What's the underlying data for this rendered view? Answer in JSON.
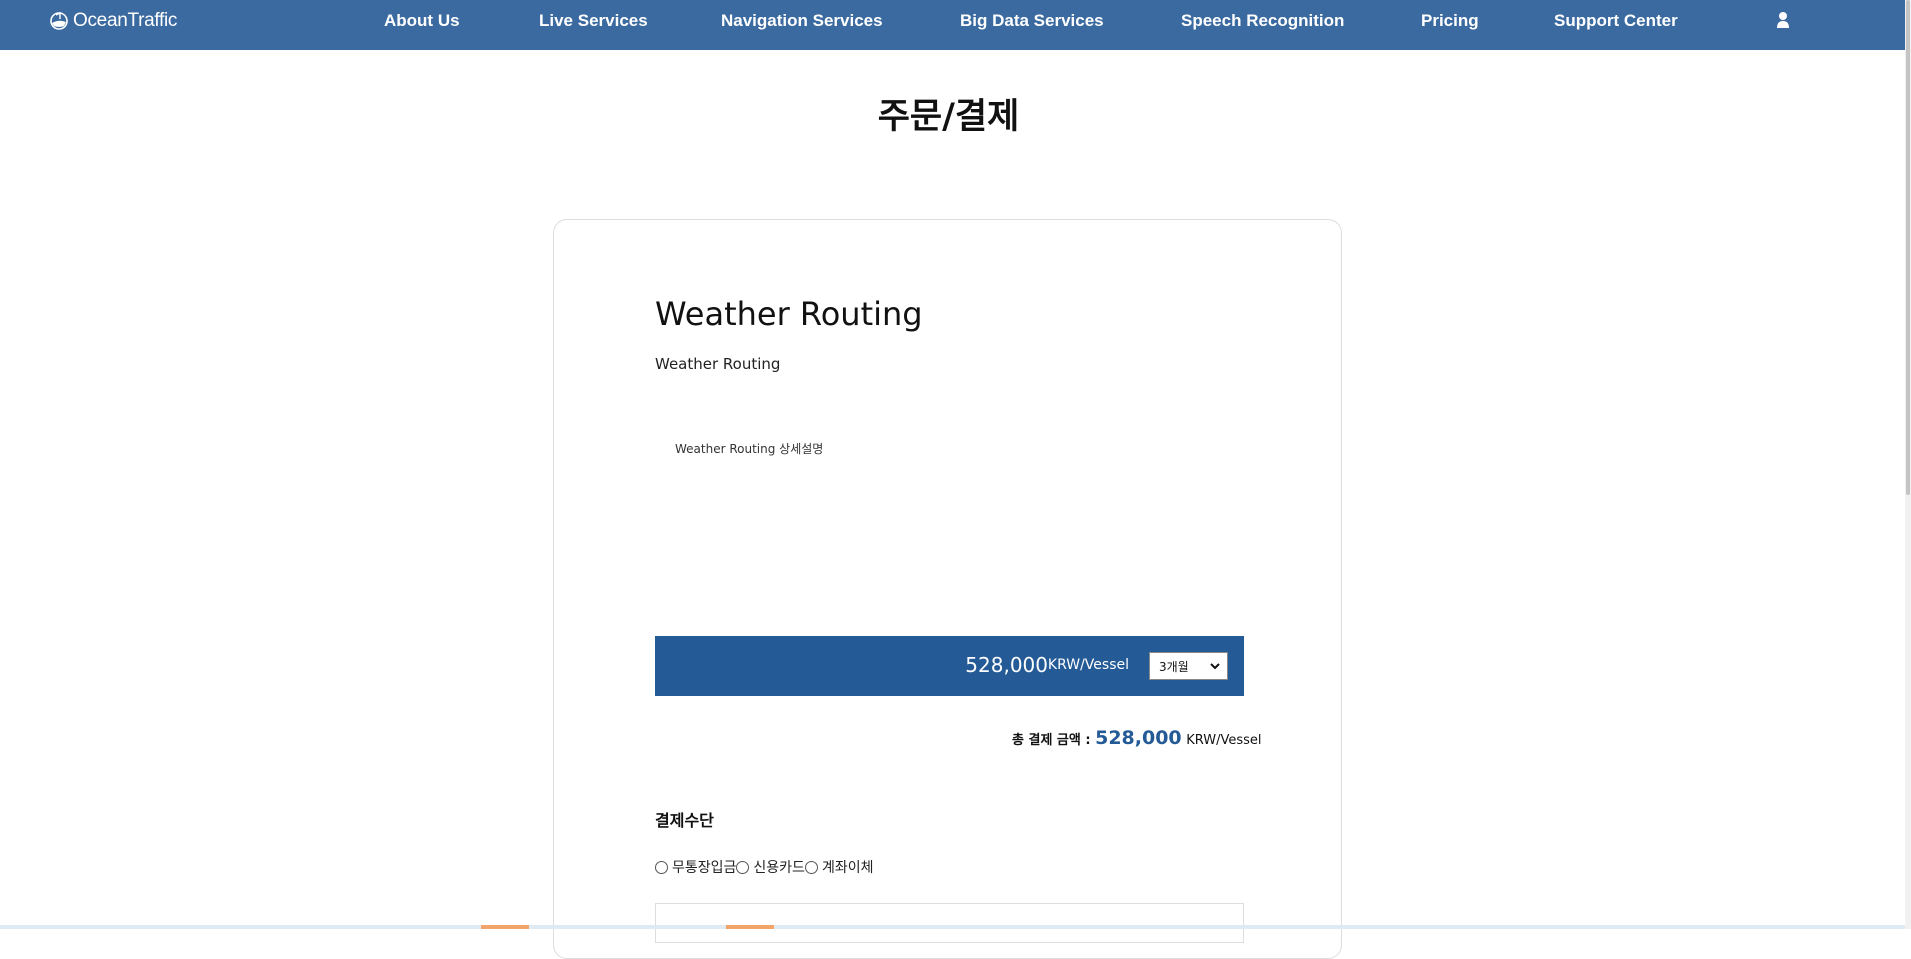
{
  "header": {
    "logo_text": "OceanTraffic",
    "nav": [
      {
        "label": "About Us"
      },
      {
        "label": "Live Services"
      },
      {
        "label": "Navigation Services"
      },
      {
        "label": "Big Data Services"
      },
      {
        "label": "Speech Recognition"
      },
      {
        "label": "Pricing"
      },
      {
        "label": "Support Center"
      }
    ],
    "user_icon": "user-icon"
  },
  "page": {
    "title": "주문/결제"
  },
  "product": {
    "title": "Weather Routing",
    "subtitle": "Weather Routing",
    "description": "Weather Routing 상세설명"
  },
  "price": {
    "amount": "528,000",
    "unit": "KRW/Vessel",
    "period_selected": "3개월"
  },
  "total": {
    "label": "총 결제 금액 : ",
    "amount": "528,000",
    "unit": "KRW/Vessel"
  },
  "payment": {
    "heading": "결제수단",
    "options": [
      {
        "label": "무통장입금"
      },
      {
        "label": "신용카드"
      },
      {
        "label": "계좌이체"
      }
    ]
  },
  "colors": {
    "header_bg": "#3b6aa0",
    "price_bar_bg": "#245b96",
    "accent": "#245b96"
  }
}
